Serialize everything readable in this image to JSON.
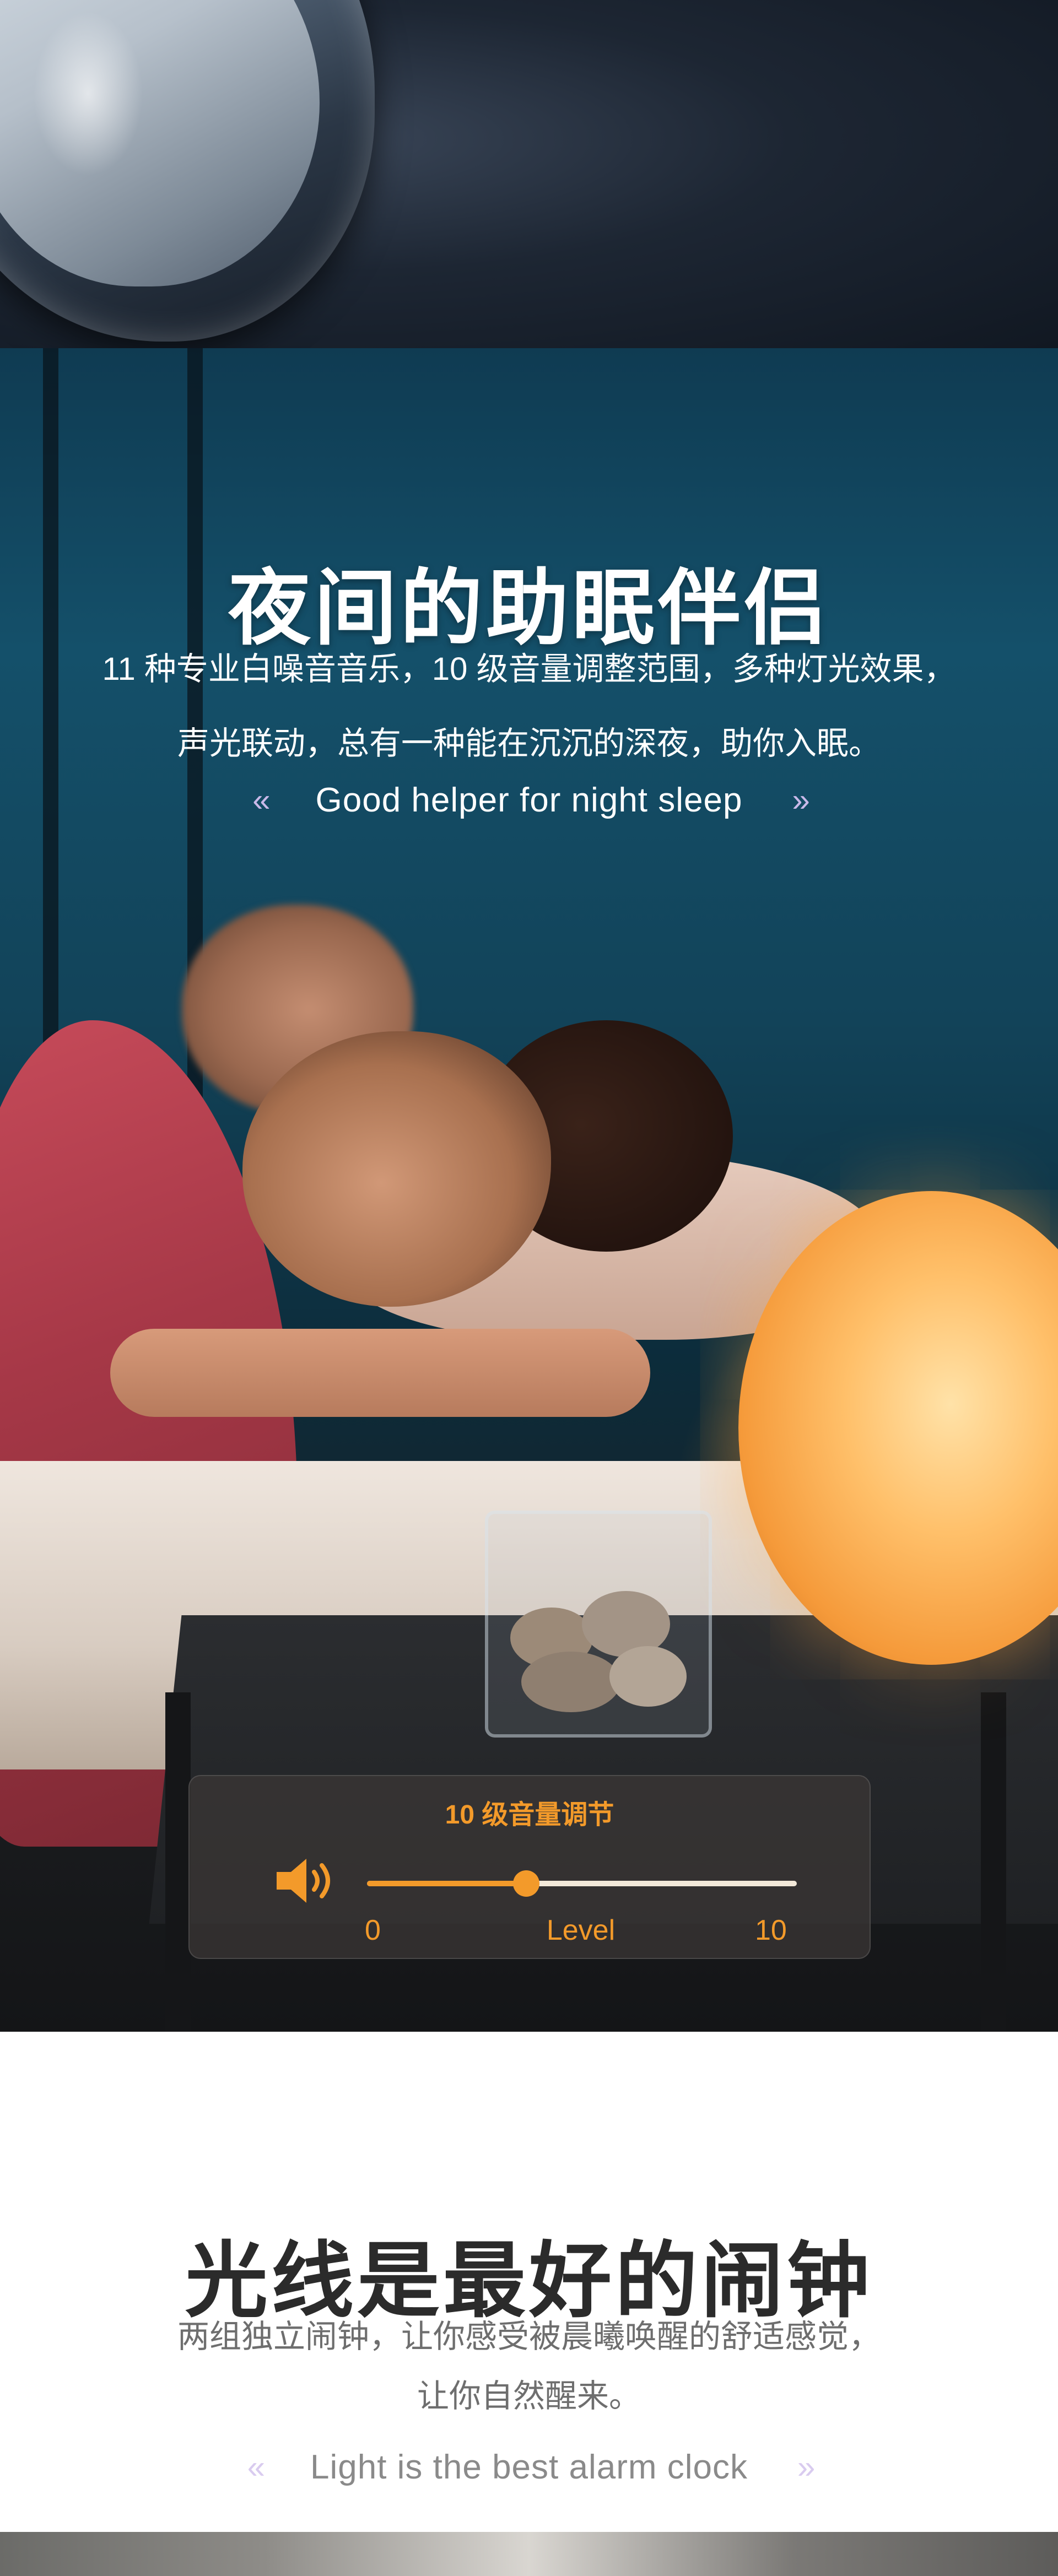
{
  "night_section": {
    "title": "夜间的助眠伴侣",
    "description_lines": [
      "11 种专业白噪音音乐，10 级音量调整范围，多种灯光效果，",
      "声光联动，总有一种能在沉沉的深夜，助你入眠。"
    ],
    "subtitle": "Good helper for night sleep",
    "chevron_left": "«",
    "chevron_right": "»"
  },
  "volume_panel": {
    "title": "10 级音量调节",
    "min_label": "0",
    "center_label": "Level",
    "max_label": "10",
    "level_fraction": 0.37,
    "accent_color": "#f39a2a",
    "icon": "speaker-icon"
  },
  "alarm_section": {
    "title": "光线是最好的闹钟",
    "description_lines": [
      "两组独立闹钟，让你感受被晨曦唤醒的舒适感觉，",
      "让你自然醒来。"
    ],
    "subtitle": "Light is the best alarm clock",
    "chevron_left": "«",
    "chevron_right": "»"
  }
}
